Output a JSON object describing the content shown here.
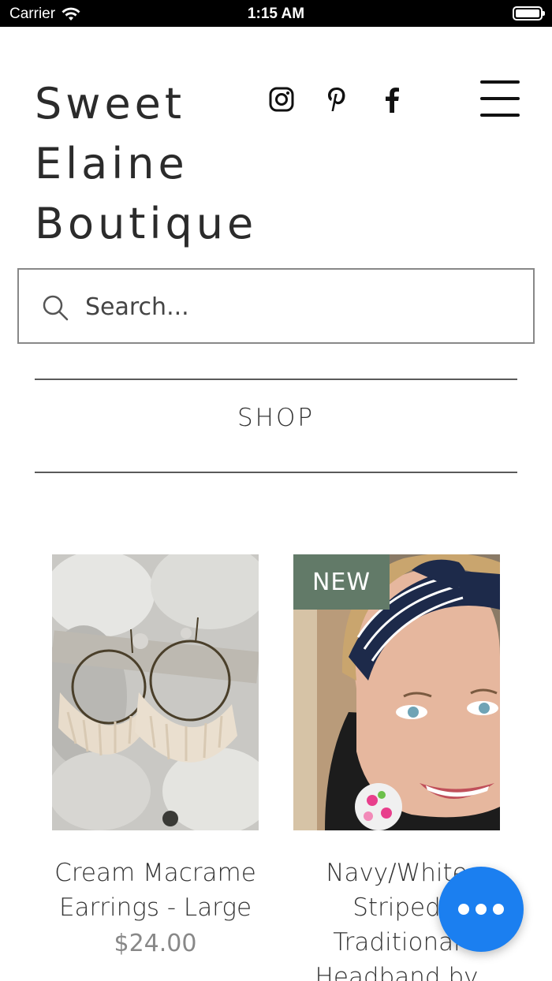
{
  "status_bar": {
    "carrier": "Carrier",
    "time": "1:15 AM"
  },
  "header": {
    "title_lines": [
      "Sweet",
      "Elaine",
      "Boutique"
    ],
    "social": [
      {
        "icon": "instagram-icon"
      },
      {
        "icon": "pinterest-icon"
      },
      {
        "icon": "facebook-icon"
      }
    ],
    "menu_icon": "hamburger-menu-icon"
  },
  "search": {
    "placeholder": "Search...",
    "value": ""
  },
  "nav": {
    "shop_label": "SHOP"
  },
  "products": [
    {
      "name": "Cream Macrame Earrings - Large",
      "price": "$24.00",
      "badge": ""
    },
    {
      "name": "Navy/White Striped Traditional Headband by Headbands of",
      "price": "",
      "badge": "NEW"
    }
  ],
  "chat_button": {
    "icon": "more-dots-icon"
  },
  "colors": {
    "badge": "#627a68",
    "fab": "#1b7ff0"
  }
}
